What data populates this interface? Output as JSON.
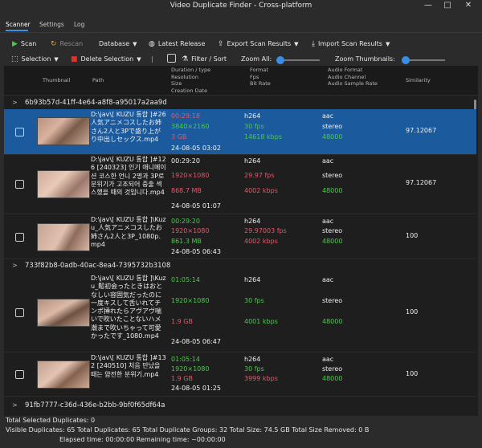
{
  "window": {
    "title": "Video Duplicate Finder - Cross-platform",
    "min": "—",
    "max": "□",
    "close": "✕"
  },
  "tabs": [
    {
      "label": "Scanner"
    },
    {
      "label": "Settings"
    },
    {
      "label": "Log"
    }
  ],
  "toolbar1": {
    "scan": "Scan",
    "rescan": "Rescan",
    "database": "Database",
    "latest_release": "Latest Release",
    "export": "Export Scan Results",
    "import": "Import Scan Results"
  },
  "toolbar2": {
    "selection": "Selection",
    "delete_selection": "Delete Selection",
    "filter_sort": "Filter / Sort",
    "zoom_all": "Zoom All:",
    "zoom_thumbnails": "Zoom Thumbnails:"
  },
  "headers": {
    "thumbnail": "Thumbnail",
    "path": "Path",
    "duration": "Duration / type",
    "resolution": "Resolution",
    "size": "Size",
    "creation": "Creation Date",
    "format": "Format",
    "fps": "Fps",
    "bitrate": "Bit Rate",
    "audio_format": "Audio Format",
    "audio_channel": "Audio Channel",
    "audio_sample_rate": "Audio Sample Rate",
    "similarity": "Similarity"
  },
  "groups": [
    {
      "name": "6b93b57d-41ff-4e64-a8f8-a95017a2aa9d"
    },
    {
      "name": "733f82b8-0adb-40ac-8ea4-7395732b3108"
    },
    {
      "name": "91fb7777-c36d-436e-b2bb-9bf0f65df64a"
    }
  ],
  "rows": [
    {
      "path": "D:\\jav\\[ KUZU 통합 ]#26\n人気アニメコスしたお姉さん2人と3Pで盛り上がり中出しセックス.mp4",
      "duration": "00:29:18",
      "resolution": "3840×2160",
      "size": "3 GB",
      "date": "24-08-05 03:02",
      "format": "h264",
      "fps": "30 fps",
      "bitrate": "14618 kbps",
      "audio_format": "aac",
      "audio_channel": "stereo",
      "audio_rate": "48000",
      "similarity": "97.12067"
    },
    {
      "path": "D:\\jav\\[ KUZU 통합 ]#126 [240323] 인기 애니메이션 코스한 언니 2명과 3P로 분위기가 고조되어 중출 섹스했을 때의 것입니다.mp4",
      "duration": "00:29:20",
      "resolution": "1920×1080",
      "size": "868.7 MB",
      "date": "24-08-05 01:07",
      "format": "h264",
      "fps": "29.97 fps",
      "bitrate": "4002 kbps",
      "audio_format": "aac",
      "audio_channel": "stereo",
      "audio_rate": "48000",
      "similarity": "97.12067"
    },
    {
      "path": "D:\\jav\\[ KUZU 통합 ]\\Kuzu_人気アニメコスしたお姉さん2人と3P_1080p.mp4",
      "duration": "00:29:20",
      "resolution": "1920×1080",
      "size": "861.3 MB",
      "date": "24-08-05 06:43",
      "format": "h264",
      "fps": "29.97003 fps",
      "bitrate": "4002 kbps",
      "audio_format": "aac",
      "audio_channel": "stereo",
      "audio_rate": "48000",
      "similarity": "100"
    },
    {
      "path": "D:\\jav\\[ KUZU 통합 ]\\Kuzu_鬆初会ったときはおとなしい容固気だったのに一度キスして舌いれてチンポ挿れたらアヴアヴ喘いで吹いたことないハメ潮まで吹いちゃって可愛かったです_1080.mp4",
      "duration": "01:05:14",
      "resolution": "1920×1080",
      "size": "1.9 GB",
      "date": "24-08-05 06:47",
      "format": "h264",
      "fps": "30 fps",
      "bitrate": "4001 kbps",
      "audio_format": "aac",
      "audio_channel": "stereo",
      "audio_rate": "48000",
      "similarity": "100"
    },
    {
      "path": "D:\\jav\\[ KUZU 통합 ]#132 [240510] 처음 만났을 때는 얌전한 분위기.mp4",
      "duration": "01:05:14",
      "resolution": "1920×1080",
      "size": "1.9 GB",
      "date": "24-08-05 01:25",
      "format": "h264",
      "fps": "30 fps",
      "bitrate": "3999 kbps",
      "audio_format": "aac",
      "audio_channel": "stereo",
      "audio_rate": "48000",
      "similarity": "100"
    }
  ],
  "status": {
    "line1": "Total Selected Duplicates: 0",
    "line2": "Visible Duplicates: 65   Total Duplicates: 65   Total Duplicate Groups: 32   Total Size: 74.5 GB   Total Size Removed: 0 B",
    "line3": "Elapsed time: 00:00:00   Remaining time: ~00:00:00"
  }
}
